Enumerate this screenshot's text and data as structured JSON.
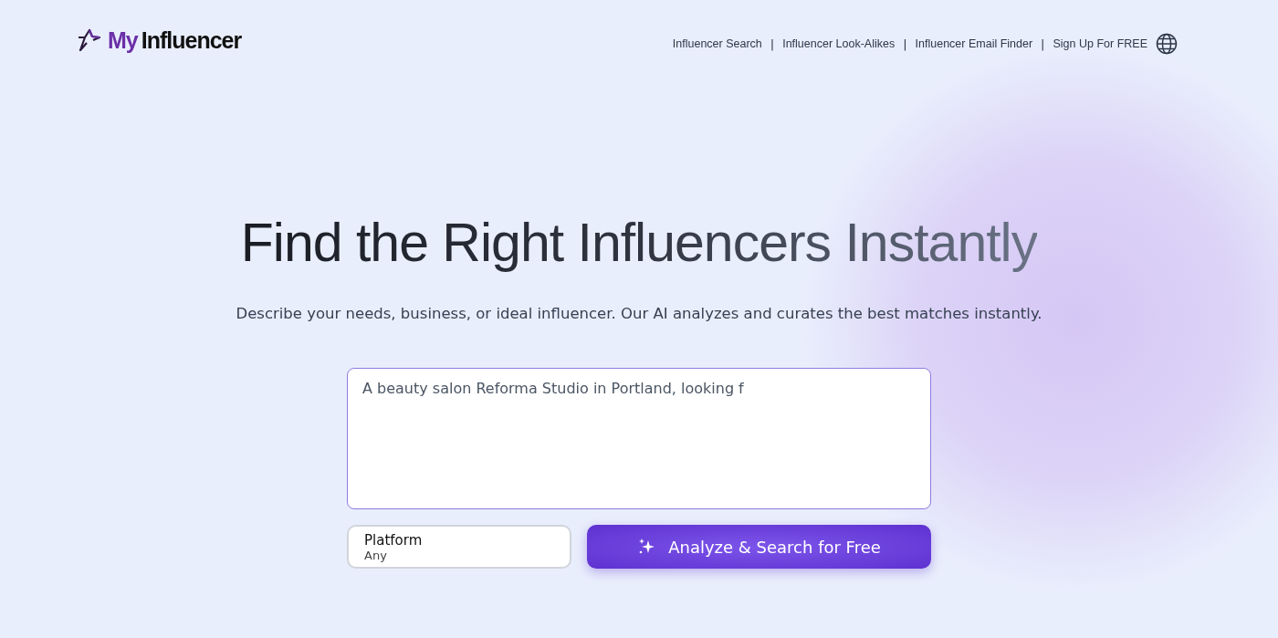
{
  "logo": {
    "prefix": "My",
    "name": "Influencer"
  },
  "nav": [
    {
      "label": "Influencer Search",
      "separator": "|"
    },
    {
      "label": "Influencer Look-Alikes",
      "separator": "|"
    },
    {
      "label": "Influencer Email Finder",
      "separator": "|"
    },
    {
      "label": "Sign Up For FREE"
    }
  ],
  "hero": {
    "title": "Find the Right Influencers Instantly",
    "subtitle": "Describe your needs, business, or ideal influencer. Our AI analyzes and curates the best matches instantly."
  },
  "query": {
    "value": "A beauty salon Reforma Studio in Portland, looking f"
  },
  "platform": {
    "label": "Platform",
    "value": "Any"
  },
  "submit": {
    "label": "Analyze & Search for Free"
  }
}
